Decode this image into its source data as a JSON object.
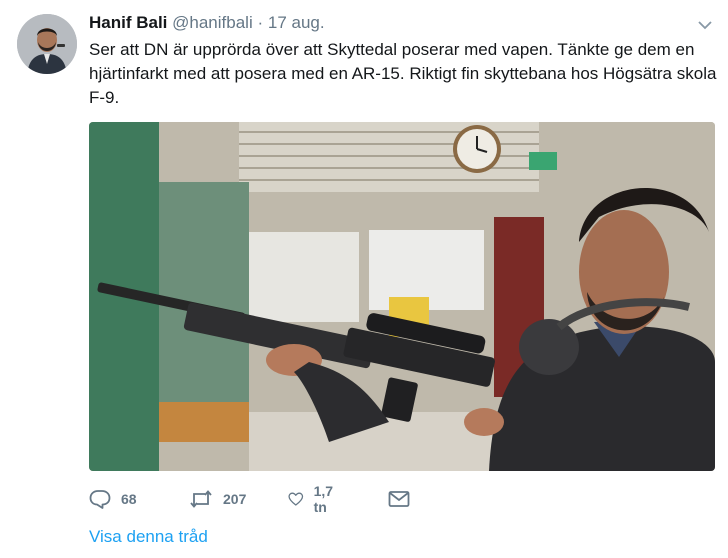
{
  "tweet": {
    "author_name": "Hanif Bali",
    "author_handle": "@hanifbali",
    "separator": "·",
    "date": "17 aug.",
    "text": "Ser att DN är upprörda över att Skyttedal poserar med vapen. Tänkte ge dem en hjärtinfarkt med att posera med en AR-15. Riktigt fin skyttebana hos Högsätra skola F-9.",
    "replies": "68",
    "retweets": "207",
    "likes": "1,7 tn",
    "show_thread": "Visa denna tråd"
  },
  "icons": {
    "reply": "reply-icon",
    "retweet": "retweet-icon",
    "like": "heart-icon",
    "dm": "envelope-icon",
    "menu": "chevron-down-icon"
  },
  "colors": {
    "link": "#1da1f2",
    "secondary_text": "#657786",
    "primary_text": "#14171a"
  }
}
